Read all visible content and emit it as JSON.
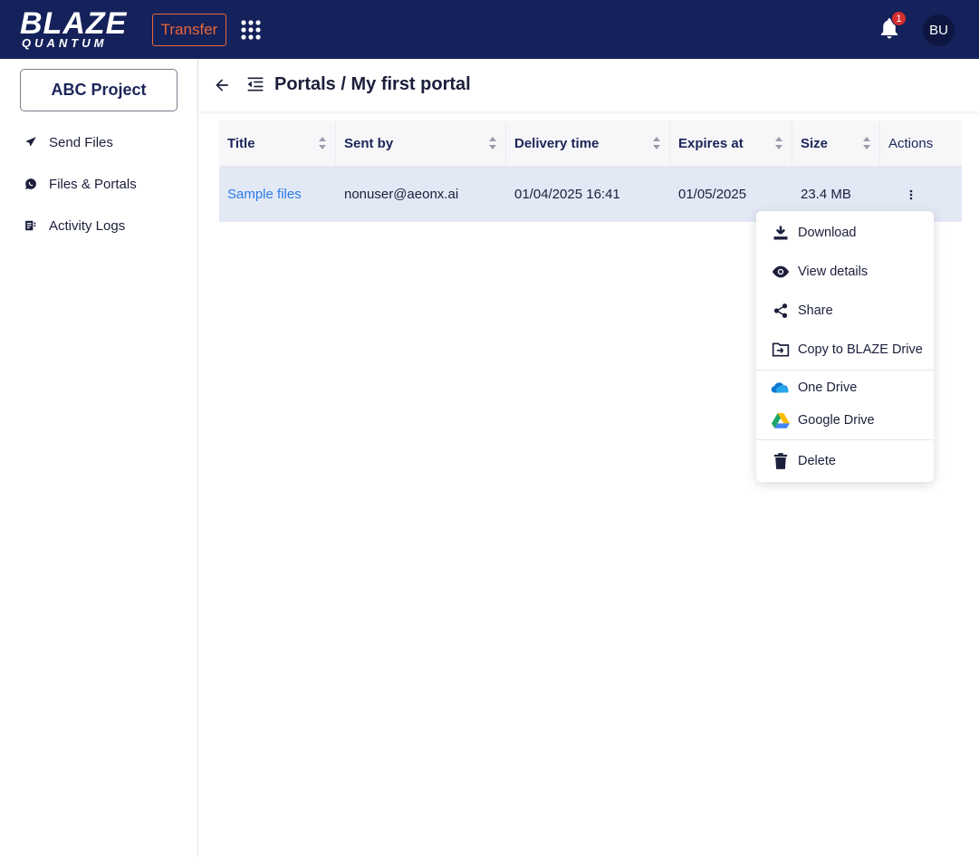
{
  "topbar": {
    "logo_main": "BLAZE",
    "logo_sub": "QUANTUM",
    "transfer_label": "Transfer",
    "notification_count": "1",
    "avatar_initials": "BU"
  },
  "sidebar": {
    "project_label": "ABC Project",
    "items": [
      {
        "label": "Send Files",
        "icon": "send-icon"
      },
      {
        "label": "Files & Portals",
        "icon": "chat-bubble-icon"
      },
      {
        "label": "Activity Logs",
        "icon": "logs-icon"
      }
    ]
  },
  "header": {
    "breadcrumb": "Portals / My first portal"
  },
  "table": {
    "columns": [
      "Title",
      "Sent by",
      "Delivery time",
      "Expires at",
      "Size",
      "Actions"
    ],
    "rows": [
      {
        "title": "Sample files",
        "sent_by": "nonuser@aeonx.ai",
        "delivery_time": "01/04/2025 16:41",
        "expires_at": "01/05/2025",
        "size": "23.4 MB"
      }
    ]
  },
  "actions_menu": {
    "items": [
      {
        "label": "Download",
        "icon": "download-icon"
      },
      {
        "label": "View details",
        "icon": "eye-icon"
      },
      {
        "label": "Share",
        "icon": "share-icon"
      },
      {
        "label": "Copy to BLAZE Drive",
        "icon": "copy-to-drive-icon"
      },
      {
        "label": "One Drive",
        "icon": "onedrive-icon"
      },
      {
        "label": "Google Drive",
        "icon": "google-drive-icon"
      },
      {
        "label": "Delete",
        "icon": "trash-icon"
      }
    ]
  },
  "colors": {
    "topbar_bg": "#15215a",
    "accent_orange": "#e8673a",
    "link_blue": "#2b7de9",
    "row_highlight": "#e3e8f5"
  }
}
